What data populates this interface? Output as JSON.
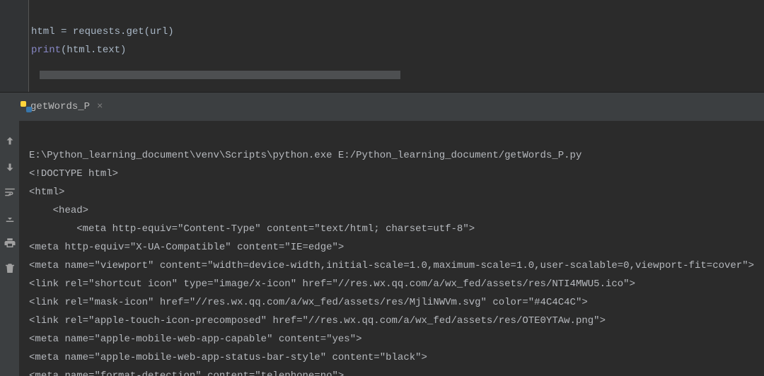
{
  "editor": {
    "line1_a": "html ",
    "line1_b": "= requests",
    "line1_c": ".",
    "line1_d": "get",
    "line1_e": "(url)",
    "line2_a": "print",
    "line2_b": "(html",
    "line2_c": ".",
    "line2_d": "text",
    "line2_e": ")"
  },
  "tab": {
    "label": "getWords_P",
    "close": "×"
  },
  "console": {
    "l1": "E:\\Python_learning_document\\venv\\Scripts\\python.exe E:/Python_learning_document/getWords_P.py",
    "l2": "<!DOCTYPE html>",
    "l3": "<html>",
    "l4": "    <head>",
    "l5": "        <meta http-equiv=\"Content-Type\" content=\"text/html; charset=utf-8\">",
    "l6": "<meta http-equiv=\"X-UA-Compatible\" content=\"IE=edge\">",
    "l7": "<meta name=\"viewport\" content=\"width=device-width,initial-scale=1.0,maximum-scale=1.0,user-scalable=0,viewport-fit=cover\">",
    "l8": "<link rel=\"shortcut icon\" type=\"image/x-icon\" href=\"//res.wx.qq.com/a/wx_fed/assets/res/NTI4MWU5.ico\">",
    "l9": "<link rel=\"mask-icon\" href=\"//res.wx.qq.com/a/wx_fed/assets/res/MjliNWVm.svg\" color=\"#4C4C4C\">",
    "l10": "<link rel=\"apple-touch-icon-precomposed\" href=\"//res.wx.qq.com/a/wx_fed/assets/res/OTE0YTAw.png\">",
    "l11": "<meta name=\"apple-mobile-web-app-capable\" content=\"yes\">",
    "l12": "<meta name=\"apple-mobile-web-app-status-bar-style\" content=\"black\">",
    "l13": "<meta name=\"format-detection\" content=\"telephone=no\">"
  },
  "icons": {
    "up": "up-arrow-icon",
    "down": "down-arrow-icon",
    "wrap": "wrap-text-icon",
    "import": "download-icon",
    "print": "print-icon",
    "trash": "trash-icon"
  }
}
